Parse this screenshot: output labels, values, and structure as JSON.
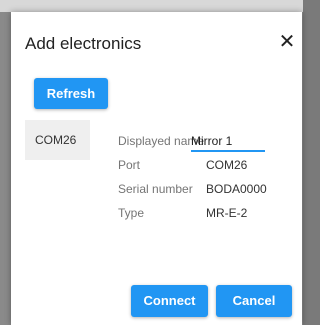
{
  "dialog": {
    "title": "Add electronics",
    "close_glyph": "✕"
  },
  "toolbar": {
    "refresh_label": "Refresh"
  },
  "devices": [
    {
      "label": "COM26",
      "selected": true
    }
  ],
  "details": {
    "displayed_name_label": "Displayed name",
    "displayed_name_value": "Mirror 1",
    "port_label": "Port",
    "port_value": "COM26",
    "serial_label": "Serial number",
    "serial_value": "BODA0000",
    "type_label": "Type",
    "type_value": "MR-E-2"
  },
  "footer": {
    "connect_label": "Connect",
    "cancel_label": "Cancel"
  },
  "colors": {
    "accent": "#2196f3",
    "selected_item_bg": "#efefef"
  }
}
